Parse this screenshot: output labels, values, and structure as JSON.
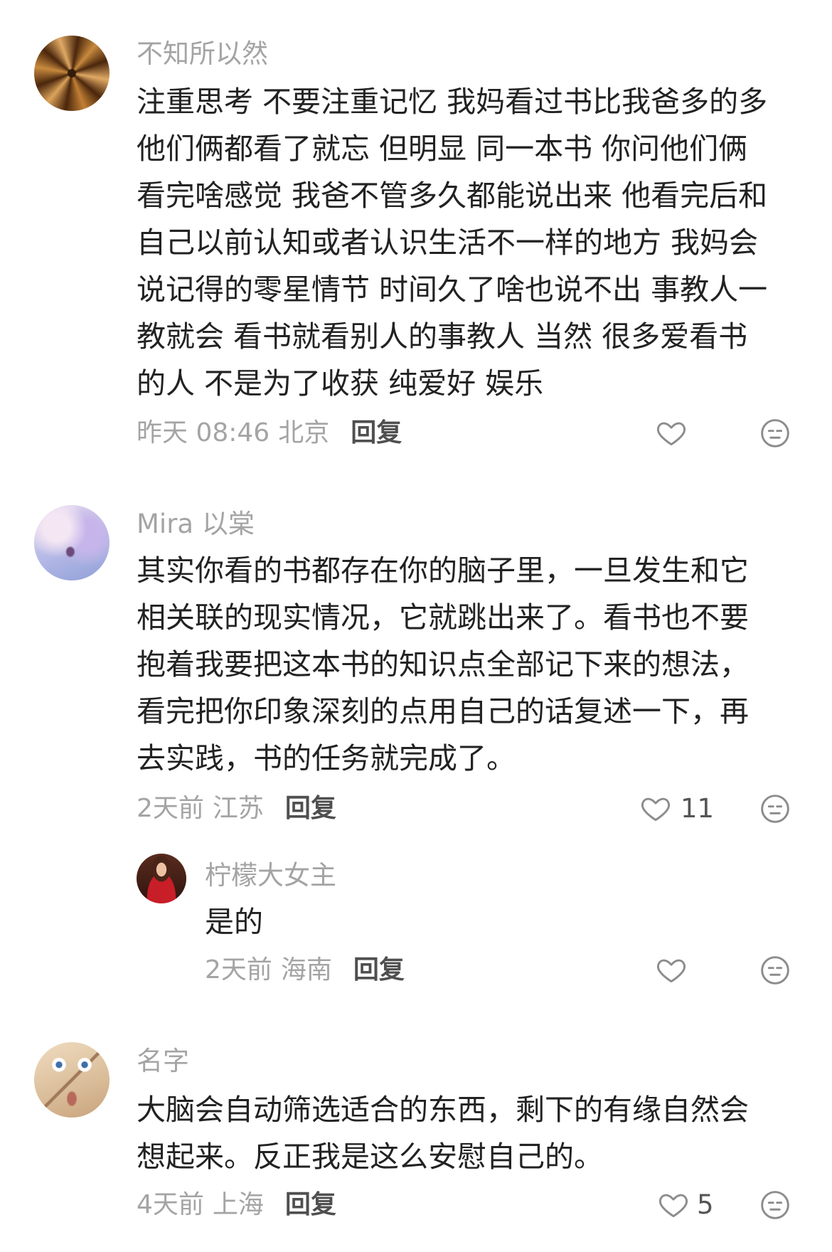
{
  "colors": {
    "text": "#222222",
    "muted": "#a4a4a4",
    "reply_label": "#4f4f4f",
    "icon": "#8c8c8c"
  },
  "icons": {
    "like": "heart-icon",
    "dislike": "neutral-face-icon"
  },
  "comments": [
    {
      "username": "不知所以然",
      "lines": [
        "注重思考 不要注重记忆 我妈看过书比我爸多的多",
        "他们俩都看了就忘 但明显 同一本书 你问他们俩",
        "看完啥感觉 我爸不管多久都能说出来 他看完后和",
        "自己以前认知或者认识生活不一样的地方 我妈会",
        "说记得的零星情节 时间久了啥也说不出 事教人一",
        "教就会 看书就看别人的事教人 当然 很多爱看书",
        "的人 不是为了收获 纯爱好 娱乐"
      ],
      "time": "昨天 08:46",
      "location": "北京",
      "reply_label": "回复"
    },
    {
      "username": "Mira 以棠",
      "lines": [
        "其实你看的书都存在你的脑子里，一旦发生和它",
        "相关联的现实情况，它就跳出来了。看书也不要",
        "抱着我要把这本书的知识点全部记下来的想法，",
        "看完把你印象深刻的点用自己的话复述一下，再",
        "去实践，书的任务就完成了。"
      ],
      "time": "2天前",
      "location": "江苏",
      "reply_label": "回复",
      "like_count": "11",
      "replies": [
        {
          "username": "柠檬大女主",
          "lines": [
            "是的"
          ],
          "time": "2天前",
          "location": "海南",
          "reply_label": "回复"
        }
      ]
    },
    {
      "username": "名字",
      "lines": [
        "大脑会自动筛选适合的东西，剩下的有缘自然会",
        "想起来。反正我是这么安慰自己的。"
      ],
      "time": "4天前",
      "location": "上海",
      "reply_label": "回复",
      "like_count": "5"
    }
  ]
}
